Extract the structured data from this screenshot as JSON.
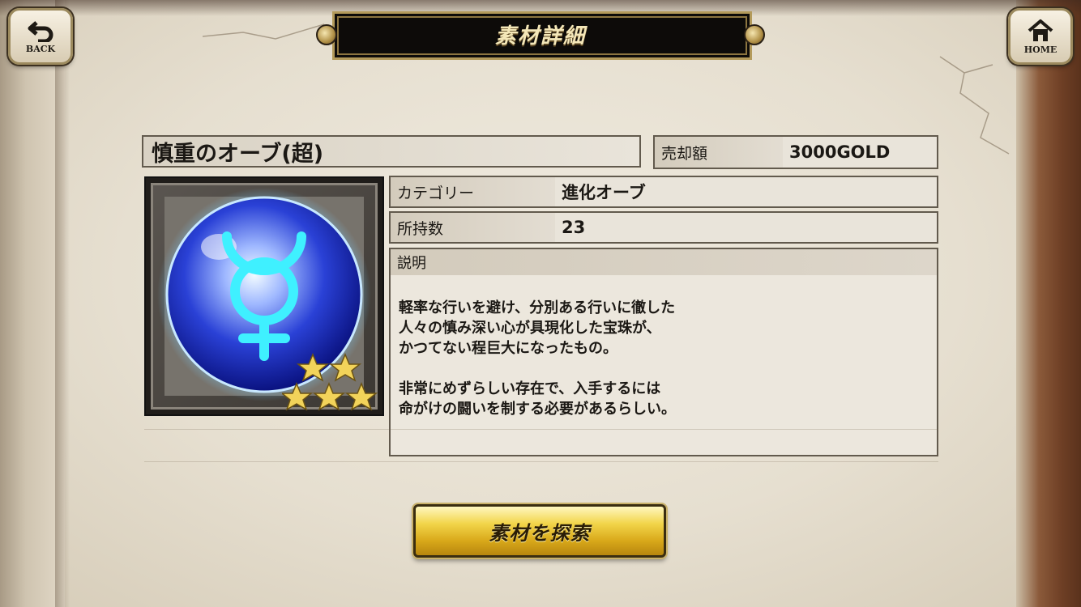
{
  "header": {
    "title": "素材詳細",
    "back_label": "BACK",
    "home_label": "HOME"
  },
  "item": {
    "name": "慎重のオーブ(超)",
    "sale_label": "売却額",
    "sale_value": "3000GOLD",
    "category_label": "カテゴリー",
    "category_value": "進化オーブ",
    "owned_label": "所持数",
    "owned_value": "23",
    "description_label": "説明",
    "description": "軽率な行いを避け、分別ある行いに徹した\n人々の慎み深い心が具現化した宝珠が、\nかつてない程巨大になったもの。\n\n非常にめずらしい存在で、入手するには\n命がけの闘いを制する必要があるらしい。",
    "rarity_stars": 5,
    "icon": "mercury-symbol-orb"
  },
  "actions": {
    "search_label": "素材を探索"
  },
  "colors": {
    "orb_glow": "#3ff0ff",
    "orb_blue": "#1b33c9",
    "star_gold": "#f2d35a",
    "button_gold": "#e6bd2a"
  }
}
